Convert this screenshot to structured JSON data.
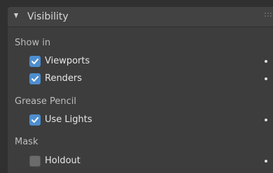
{
  "panel": {
    "title": "Visibility",
    "sections": [
      {
        "label": "Show in",
        "items": [
          {
            "label": "Viewports",
            "checked": true
          },
          {
            "label": "Renders",
            "checked": true
          }
        ]
      },
      {
        "label": "Grease Pencil",
        "items": [
          {
            "label": "Use Lights",
            "checked": true
          }
        ]
      },
      {
        "label": "Mask",
        "items": [
          {
            "label": "Holdout",
            "checked": false
          }
        ]
      }
    ]
  },
  "colors": {
    "background": "#303030",
    "panel": "#3d3d3d",
    "checkbox_on": "#4e8ecf",
    "checkbox_off": "#6b6b6b"
  },
  "icons": {
    "collapse": "triangle-down-icon",
    "grip": "drag-handle-icon",
    "check": "checkmark-icon",
    "keyframe": "animate-dot-icon"
  }
}
